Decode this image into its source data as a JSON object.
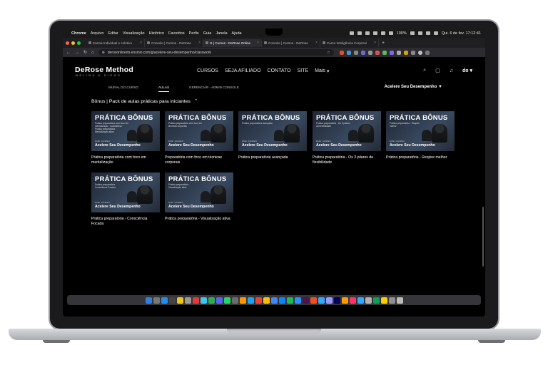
{
  "menubar": {
    "app_name": "Chrome",
    "items": [
      "Arquivo",
      "Editar",
      "Visualização",
      "Histórico",
      "Favoritos",
      "Perfis",
      "Guia",
      "Janela",
      "Ajuda"
    ],
    "battery": "100%",
    "datetime": "Qui. 6 de fev. 17:12:41"
  },
  "browser": {
    "tabs": [
      {
        "title": "Karma Individual e coletivo",
        "active": false
      },
      {
        "title": "Console | Cursos - DeRose",
        "active": false
      },
      {
        "title": "G | Cursos - DeRose Online",
        "active": true
      },
      {
        "title": "Console | Cursos - DeRose",
        "active": false
      },
      {
        "title": "Curso Inteligência Corporal",
        "active": false
      }
    ],
    "url": "derosonlinerio.ensinio.com/g/acelere-seu-desempenho/classwork"
  },
  "site": {
    "logo": "DeRose Method",
    "logo_sub": "MELINA & DIEGO",
    "nav": [
      "CURSOS",
      "SEJA AFILIADO",
      "CONTATO",
      "SITE"
    ],
    "more_label": "Mais",
    "avatar_label": "do"
  },
  "subnav": {
    "tabs": [
      "MURAL DO CURSO",
      "AULAS",
      "GERENCIAR - ADMIN CONSOLE"
    ],
    "active_tab": "AULAS",
    "course_select": "Acelere Seu Desempenho"
  },
  "section": {
    "title": "Bônus | Pack de aulas práticas para iniciantes"
  },
  "thumbnail": {
    "title": "PRÁTICA BÔNUS",
    "mini_label": "MINI CURSO",
    "course_label": "Acelere Seu Desempenho"
  },
  "lessons": [
    {
      "desc": "Prática preparatória com foco em mentalização · Autodefesa · Prática preparatória · Mentalização ativa",
      "caption": "Prática preparatória com foco em mentalização"
    },
    {
      "desc": "Prática preparatória com foco em técnicas corporais",
      "caption": "Preparatória com foco em técnicas corporais"
    },
    {
      "desc": "Prática preparatória avançada",
      "caption": "Prática preparatória avançada"
    },
    {
      "desc": "Prática preparatória - Os 3 pilares da flexibilidade",
      "caption": "Prática preparatória - Os 3 pilares da flexibilidade"
    },
    {
      "desc": "Prática preparatória - Respire melhor",
      "caption": "Prática preparatória - Respire melhor"
    },
    {
      "desc": "Prática preparatória - Consciência Focada",
      "caption": "Prática preparatória - Consciência Focada"
    },
    {
      "desc": "Prática preparatória - Visualização ativa",
      "caption": "Prática preparatória - Visualização ativa"
    }
  ],
  "colors": {
    "page_bg": "#000000",
    "text": "#ffffff",
    "laptop_frame": "#1b1b1d",
    "laptop_base": "#c4c5ca"
  }
}
